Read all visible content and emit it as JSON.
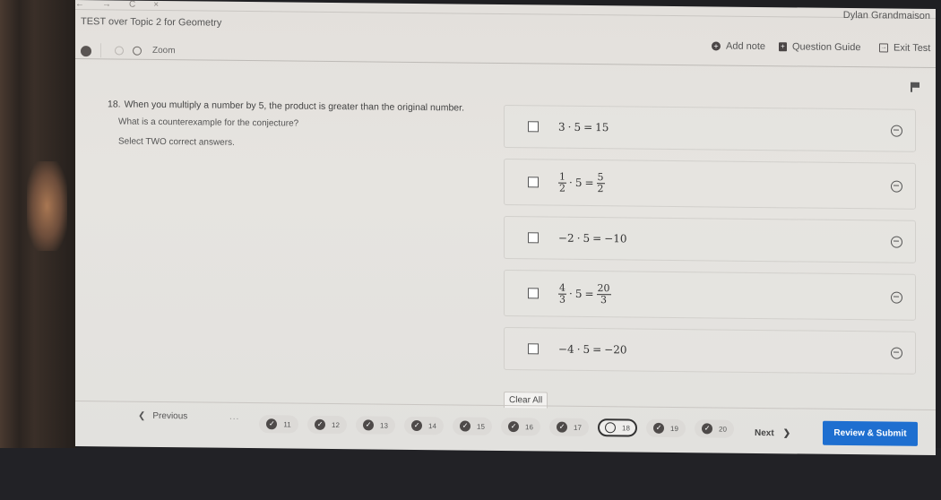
{
  "browser": {
    "back_icon": "←",
    "forward_icon": "→",
    "reload_icon": "C",
    "close_icon": "×"
  },
  "header": {
    "test_title": "TEST over Topic 2 for Geometry",
    "user_name": "Dylan Grandmaison"
  },
  "toolbar": {
    "zoom_label": "Zoom",
    "add_note_label": "Add note",
    "add_note_icon": "+",
    "question_guide_label": "Question Guide",
    "question_guide_icon": "+",
    "exit_test_label": "Exit Test",
    "exit_test_icon": "→"
  },
  "question": {
    "number": "18.",
    "stem": "When you multiply a number by 5, the product is greater than the original number.",
    "prompt": "What is a counterexample for the conjecture?",
    "instruction": "Select TWO correct answers."
  },
  "answers": [
    {
      "parts": {
        "a": "3",
        "op": "·",
        "b": "5",
        "eq": "=",
        "result": "15"
      }
    },
    {
      "frac_a": {
        "num": "1",
        "den": "2"
      },
      "op": "·",
      "b": "5",
      "eq": "=",
      "frac_r": {
        "num": "5",
        "den": "2"
      }
    },
    {
      "parts": {
        "a": "−2",
        "op": "·",
        "b": "5",
        "eq": "=",
        "result": "−10"
      }
    },
    {
      "frac_a": {
        "num": "4",
        "den": "3"
      },
      "op": "·",
      "b": "5",
      "eq": "=",
      "frac_r": {
        "num": "20",
        "den": "3"
      }
    },
    {
      "parts": {
        "a": "−4",
        "op": "·",
        "b": "5",
        "eq": "=",
        "result": "−20"
      }
    }
  ],
  "clear_all_label": "Clear All",
  "footer": {
    "previous_label": "Previous",
    "previous_icon": "❮",
    "ellipsis": "...",
    "next_label": "Next",
    "next_icon": "❯",
    "review_submit_label": "Review & Submit",
    "check_icon": "✓",
    "questions": [
      {
        "number": "11",
        "status": "answered"
      },
      {
        "number": "12",
        "status": "answered"
      },
      {
        "number": "13",
        "status": "answered"
      },
      {
        "number": "14",
        "status": "answered"
      },
      {
        "number": "15",
        "status": "answered"
      },
      {
        "number": "16",
        "status": "answered"
      },
      {
        "number": "17",
        "status": "answered"
      },
      {
        "number": "18",
        "status": "current"
      },
      {
        "number": "19",
        "status": "answered"
      },
      {
        "number": "20",
        "status": "answered"
      }
    ]
  },
  "colors": {
    "primary_button": "#1e6fd0"
  }
}
